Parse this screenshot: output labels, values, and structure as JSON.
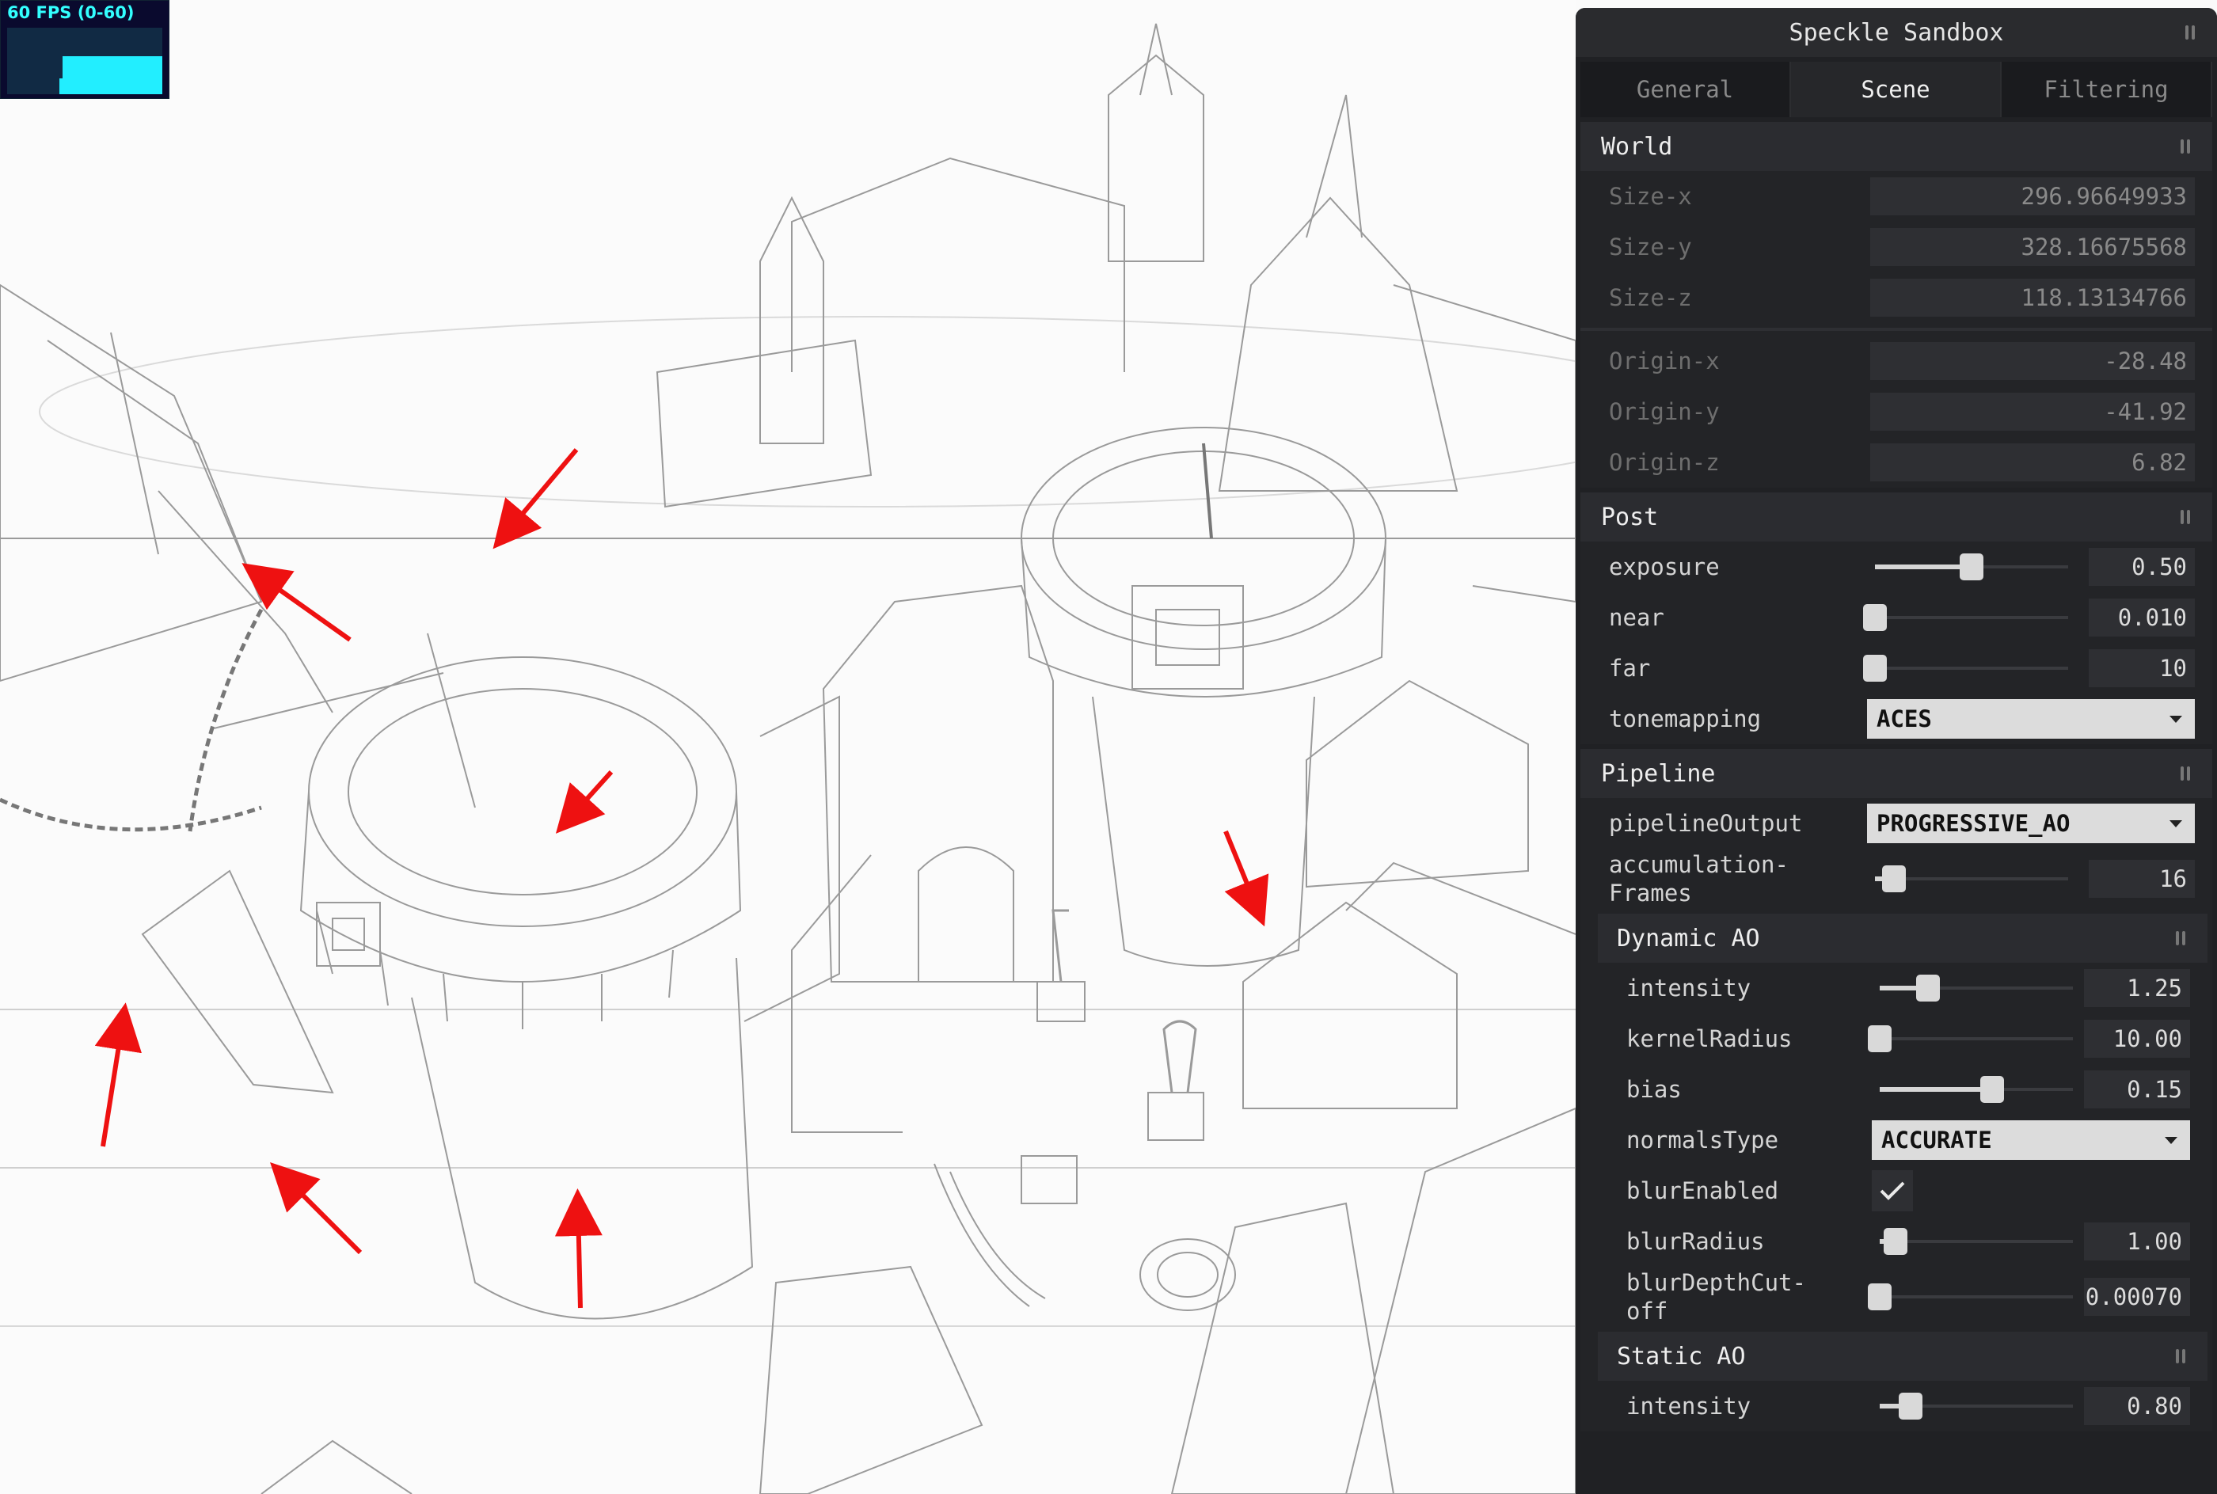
{
  "fps": {
    "label": "60 FPS (0-60)"
  },
  "panel": {
    "title": "Speckle Sandbox",
    "tabs": [
      {
        "label": "General",
        "active": false
      },
      {
        "label": "Scene",
        "active": true
      },
      {
        "label": "Filtering",
        "active": false
      }
    ],
    "world": {
      "title": "World",
      "size_x": {
        "label": "Size-x",
        "value": "296.96649933"
      },
      "size_y": {
        "label": "Size-y",
        "value": "328.16675568"
      },
      "size_z": {
        "label": "Size-z",
        "value": "118.13134766"
      },
      "origin_x": {
        "label": "Origin-x",
        "value": "-28.48"
      },
      "origin_y": {
        "label": "Origin-y",
        "value": "-41.92"
      },
      "origin_z": {
        "label": "Origin-z",
        "value": "6.82"
      }
    },
    "post": {
      "title": "Post",
      "exposure": {
        "label": "exposure",
        "value": "0.50",
        "fraction": 0.5
      },
      "near": {
        "label": "near",
        "value": "0.010",
        "fraction": 0.0
      },
      "far": {
        "label": "far",
        "value": "10",
        "fraction": 0.0
      },
      "tonemapping": {
        "label": "tonemapping",
        "value": "ACES"
      }
    },
    "pipeline": {
      "title": "Pipeline",
      "pipelineOutput": {
        "label": "pipelineOutput",
        "value": "PROGRESSIVE_AO"
      },
      "accumulationFrames": {
        "label1": "accumulation-",
        "label2": "Frames",
        "value": "16",
        "fraction": 0.1
      },
      "dynamic_ao": {
        "title": "Dynamic AO",
        "intensity": {
          "label": "intensity",
          "value": "1.25",
          "fraction": 0.25
        },
        "kernelRadius": {
          "label": "kernelRadius",
          "value": "10.00",
          "fraction": 0.0
        },
        "bias": {
          "label": "bias",
          "value": "0.15",
          "fraction": 0.58
        },
        "normalsType": {
          "label": "normalsType",
          "value": "ACCURATE"
        },
        "blurEnabled": {
          "label": "blurEnabled",
          "checked": true
        },
        "blurRadius": {
          "label": "blurRadius",
          "value": "1.00",
          "fraction": 0.08
        },
        "blurDepthCutoff": {
          "label1": "blurDepthCut-",
          "label2": "off",
          "value": "0.00070",
          "fraction": 0.0
        }
      },
      "static_ao": {
        "title": "Static AO",
        "intensity": {
          "label": "intensity",
          "value": "0.80",
          "fraction": 0.16
        }
      }
    }
  }
}
